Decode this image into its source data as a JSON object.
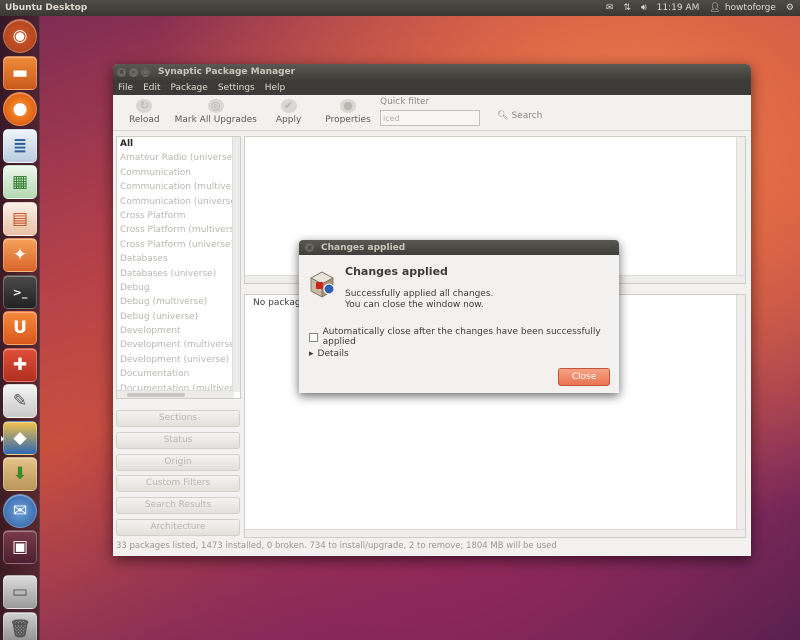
{
  "top_panel": {
    "title": "Ubuntu Desktop",
    "time": "11:19 AM",
    "user": "howtoforge"
  },
  "launcher": {
    "items": [
      "ubuntu-dash-icon",
      "files-icon",
      "firefox-icon",
      "writer-icon",
      "calc-icon",
      "impress-icon",
      "software-center-icon",
      "terminal-icon",
      "ubuntu-one-icon",
      "system-settings-icon",
      "text-editor-icon",
      "synaptic-icon",
      "archive-manager-icon",
      "thunderbird-icon",
      "workspace-switcher-icon",
      "drive-icon",
      "trash-icon"
    ]
  },
  "synaptic": {
    "title": "Synaptic Package Manager",
    "menu": [
      "File",
      "Edit",
      "Package",
      "Settings",
      "Help"
    ],
    "toolbar": {
      "reload": "Reload",
      "mark_all": "Mark All Upgrades",
      "apply": "Apply",
      "properties": "Properties",
      "quick_filter_label": "Quick filter",
      "quick_filter_value": "iced",
      "search": "Search"
    },
    "filters": [
      "All",
      "Amateur Radio (universe)",
      "Communication",
      "Communication (multiverse)",
      "Communication (universe)",
      "Cross Platform",
      "Cross Platform (multiverse)",
      "Cross Platform (universe)",
      "Databases",
      "Databases (universe)",
      "Debug",
      "Debug (multiverse)",
      "Debug (universe)",
      "Development",
      "Development (multiverse)",
      "Development (universe)",
      "Documentation",
      "Documentation (multiverse)"
    ],
    "side_buttons": [
      "Sections",
      "Status",
      "Origin",
      "Custom Filters",
      "Search Results",
      "Architecture"
    ],
    "desc_text": "No package is selected.",
    "status": "33 packages listed, 1473 installed, 0 broken. 734 to install/upgrade, 2 to remove; 1804 MB will be used"
  },
  "dialog": {
    "title": "Changes applied",
    "heading": "Changes applied",
    "msg1": "Successfully applied all changes.",
    "msg2": "You can close the window now.",
    "checkbox": "Automatically close after the changes have been successfully applied",
    "details": "Details",
    "close": "Close"
  }
}
